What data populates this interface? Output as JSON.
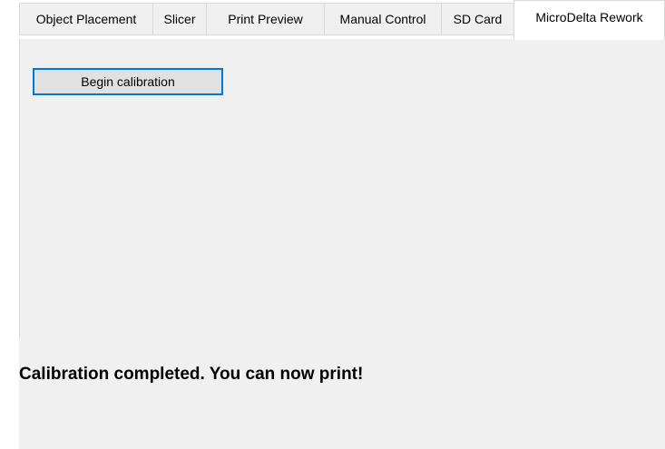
{
  "tabs": [
    {
      "label": "Object Placement",
      "active": false
    },
    {
      "label": "Slicer",
      "active": false
    },
    {
      "label": "Print Preview",
      "active": false
    },
    {
      "label": "Manual Control",
      "active": false
    },
    {
      "label": "SD Card",
      "active": false
    },
    {
      "label": "MicroDelta Rework",
      "active": true
    }
  ],
  "calibration": {
    "begin_button_label": "Begin calibration",
    "status_message": "Calibration completed. You can now print!"
  },
  "colors": {
    "focus_border": "#0078d7",
    "panel_background": "#f0f0f0"
  }
}
